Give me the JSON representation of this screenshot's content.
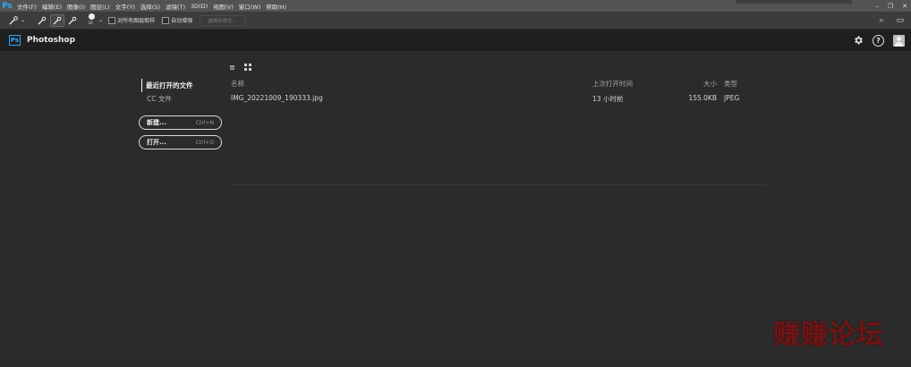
{
  "menubar": {
    "logo": "Ps",
    "items": [
      "文件(F)",
      "编辑(E)",
      "图像(I)",
      "图层(L)",
      "文字(Y)",
      "选择(S)",
      "滤镜(T)",
      "3D(D)",
      "视图(V)",
      "窗口(W)",
      "帮助(H)"
    ],
    "window_controls": {
      "minimize": "–",
      "restore": "❐",
      "close": "✕"
    }
  },
  "options_bar": {
    "brush_size": "30",
    "sample_all_layers": "对所有图层取样",
    "auto_enhance": "自动增强",
    "select_subject": "选择并遮住..."
  },
  "header": {
    "badge": "Ps",
    "app_name": "Photoshop"
  },
  "left_nav": {
    "recent": "最近打开的文件",
    "cc_files": "CC 文件",
    "new_button": {
      "label": "新建...",
      "shortcut": "Ctrl+N"
    },
    "open_button": {
      "label": "打开...",
      "shortcut": "Ctrl+O"
    }
  },
  "file_list": {
    "columns": {
      "name": "名称",
      "last_opened": "上次打开时间",
      "size": "大小",
      "type": "类型"
    },
    "rows": [
      {
        "name": "IMG_20221009_190333.jpg",
        "last_opened": "13 小时前",
        "size": "155.0KB",
        "type": "JPEG"
      }
    ]
  },
  "watermark": "赚赚论坛",
  "colors": {
    "menubar": "#535353",
    "optbar": "#3c3c3c",
    "header": "#1f1f1f",
    "background": "#2b2b2b",
    "ps_blue": "#31a8ff",
    "watermark": "#6e1616"
  }
}
